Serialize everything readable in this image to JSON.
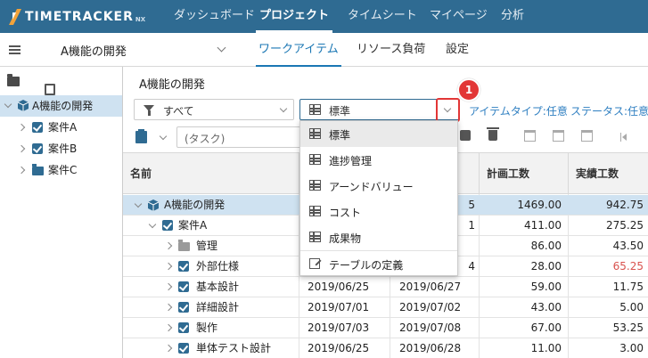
{
  "app": {
    "logo_text": "TIMETRACKER",
    "logo_suffix": "NX"
  },
  "topnav": [
    "ダッシュボード",
    "プロジェクト",
    "タイムシート",
    "マイページ",
    "分析"
  ],
  "subbar": {
    "project_title": "A機能の開発",
    "tabs": [
      "ワークアイテム",
      "リソース負荷",
      "設定"
    ]
  },
  "tree": [
    {
      "label": "A機能の開発"
    },
    {
      "label": "案件A"
    },
    {
      "label": "案件B"
    },
    {
      "label": "案件C"
    }
  ],
  "main": {
    "title": "A機能の開発",
    "filter_value": "すべて",
    "view_value": "標準",
    "step_number": "1",
    "item_type_filter": "アイテムタイプ:任意",
    "status_filter": "ステータス:任意",
    "task_placeholder": "(タスク)"
  },
  "dropdown": {
    "items": [
      "標準",
      "進捗管理",
      "アーンドバリュー",
      "コスト",
      "成果物"
    ],
    "table_def": "テーブルの定義"
  },
  "grid": {
    "headers": {
      "name": "名前",
      "planned": "計画工数",
      "actual": "実績工数"
    },
    "rows": [
      {
        "name": "A機能の開発",
        "start": "",
        "end": "5",
        "planned": "1469.00",
        "actual": "942.75"
      },
      {
        "name": "案件A",
        "start": "",
        "end": "1",
        "planned": "411.00",
        "actual": "275.25"
      },
      {
        "name": "管理",
        "start": "",
        "end": "",
        "planned": "86.00",
        "actual": "43.50"
      },
      {
        "name": "外部仕様",
        "start": "",
        "end": "4",
        "planned": "28.00",
        "actual": "65.25"
      },
      {
        "name": "基本設計",
        "start": "2019/06/25",
        "end": "2019/06/27",
        "planned": "59.00",
        "actual": "11.75"
      },
      {
        "name": "詳細設計",
        "start": "2019/07/01",
        "end": "2019/07/02",
        "planned": "43.00",
        "actual": "5.00"
      },
      {
        "name": "製作",
        "start": "2019/07/03",
        "end": "2019/07/08",
        "planned": "67.00",
        "actual": "53.25"
      },
      {
        "name": "単体テスト設計",
        "start": "2019/06/25",
        "end": "2019/06/28",
        "planned": "11.00",
        "actual": "3.00"
      }
    ]
  },
  "colors": {
    "header_bg": "#2f6b92",
    "accent": "#1b77b4",
    "highlight": "#e23636",
    "over_budget": "#d9534f"
  }
}
